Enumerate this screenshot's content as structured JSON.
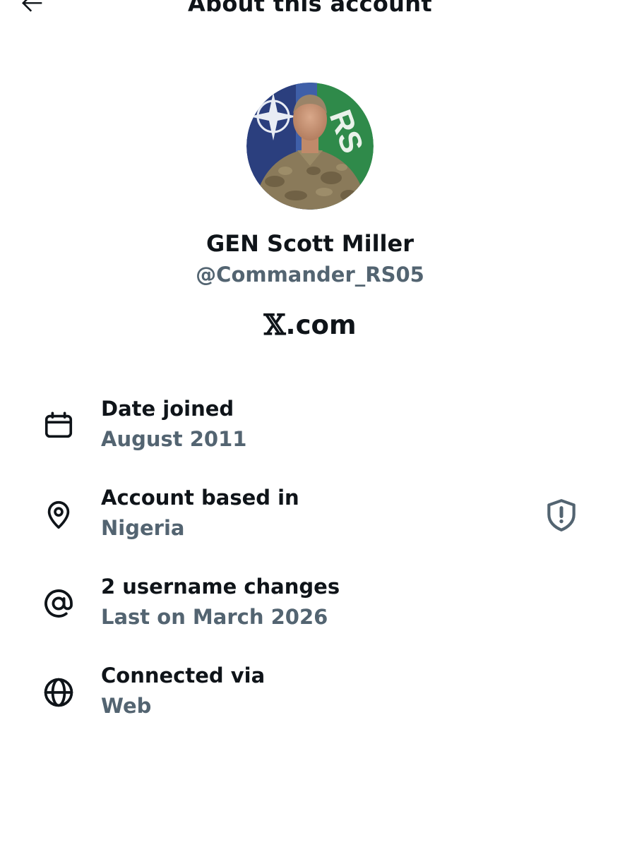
{
  "header": {
    "title": "About this account",
    "back_icon": "arrow-left-icon"
  },
  "profile": {
    "display_name": "GEN Scott Miller",
    "handle": "@Commander_RS05",
    "platform_logo": "𝕏",
    "platform_suffix": ".com"
  },
  "details": [
    {
      "icon": "calendar-icon",
      "label": "Date joined",
      "value": "August 2011"
    },
    {
      "icon": "location-pin-icon",
      "label": "Account based in",
      "value": "Nigeria"
    },
    {
      "icon": "at-sign-icon",
      "label": "2 username changes",
      "value": "Last on March 2026"
    },
    {
      "icon": "globe-icon",
      "label": "Connected via",
      "value": "Web"
    }
  ],
  "colors": {
    "text_primary": "#0f1419",
    "text_secondary": "#536471",
    "background": "#ffffff"
  }
}
